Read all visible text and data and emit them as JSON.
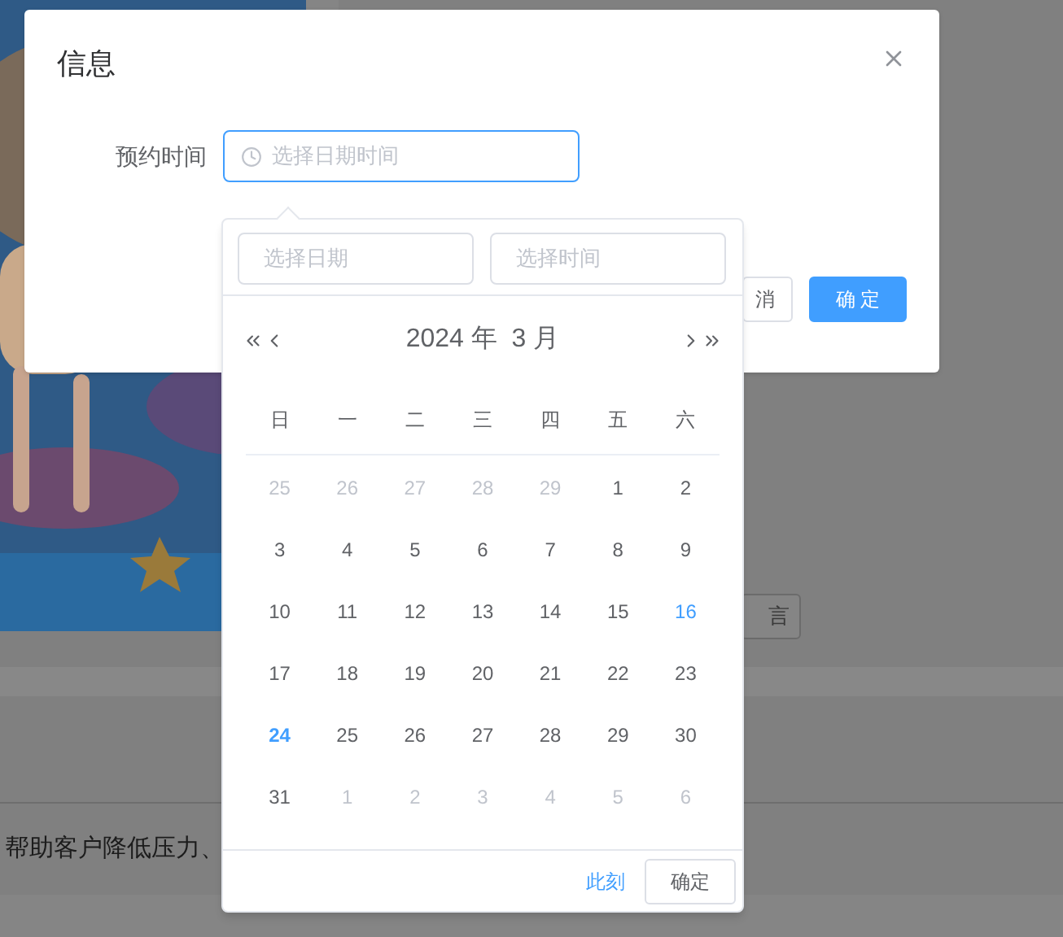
{
  "background": {
    "button": "言",
    "text": "帮助客户降低压力、"
  },
  "dialog": {
    "title": "信息",
    "field": {
      "label": "预约时间",
      "placeholder": "选择日期时间",
      "focused": true
    },
    "buttons": [
      {
        "label": "消",
        "kind": "default"
      },
      {
        "label": "确 定",
        "kind": "primary"
      }
    ]
  },
  "picker": {
    "date_placeholder": "选择日期",
    "time_placeholder": "选择时间",
    "title": "2024 年  3 月",
    "weekdays": [
      "日",
      "一",
      "二",
      "三",
      "四",
      "五",
      "六"
    ],
    "weeks": [
      [
        {
          "label": "25",
          "muted": true,
          "today": false,
          "marked": false
        },
        {
          "label": "26",
          "muted": true,
          "today": false,
          "marked": false
        },
        {
          "label": "27",
          "muted": true,
          "today": false,
          "marked": false
        },
        {
          "label": "28",
          "muted": true,
          "today": false,
          "marked": false
        },
        {
          "label": "29",
          "muted": true,
          "today": false,
          "marked": false
        },
        {
          "label": "1",
          "muted": false,
          "today": false,
          "marked": false
        },
        {
          "label": "2",
          "muted": false,
          "today": false,
          "marked": false
        }
      ],
      [
        {
          "label": "3",
          "muted": false,
          "today": false,
          "marked": false
        },
        {
          "label": "4",
          "muted": false,
          "today": false,
          "marked": false
        },
        {
          "label": "5",
          "muted": false,
          "today": false,
          "marked": false
        },
        {
          "label": "6",
          "muted": false,
          "today": false,
          "marked": false
        },
        {
          "label": "7",
          "muted": false,
          "today": false,
          "marked": false
        },
        {
          "label": "8",
          "muted": false,
          "today": false,
          "marked": false
        },
        {
          "label": "9",
          "muted": false,
          "today": false,
          "marked": false
        }
      ],
      [
        {
          "label": "10",
          "muted": false,
          "today": false,
          "marked": false
        },
        {
          "label": "11",
          "muted": false,
          "today": false,
          "marked": false
        },
        {
          "label": "12",
          "muted": false,
          "today": false,
          "marked": false
        },
        {
          "label": "13",
          "muted": false,
          "today": false,
          "marked": false
        },
        {
          "label": "14",
          "muted": false,
          "today": false,
          "marked": false
        },
        {
          "label": "15",
          "muted": false,
          "today": false,
          "marked": false
        },
        {
          "label": "16",
          "muted": false,
          "today": false,
          "marked": true
        }
      ],
      [
        {
          "label": "17",
          "muted": false,
          "today": false,
          "marked": false
        },
        {
          "label": "18",
          "muted": false,
          "today": false,
          "marked": false
        },
        {
          "label": "19",
          "muted": false,
          "today": false,
          "marked": false
        },
        {
          "label": "20",
          "muted": false,
          "today": false,
          "marked": false
        },
        {
          "label": "21",
          "muted": false,
          "today": false,
          "marked": false
        },
        {
          "label": "22",
          "muted": false,
          "today": false,
          "marked": false
        },
        {
          "label": "23",
          "muted": false,
          "today": false,
          "marked": false
        }
      ],
      [
        {
          "label": "24",
          "muted": false,
          "today": true,
          "marked": false
        },
        {
          "label": "25",
          "muted": false,
          "today": false,
          "marked": false
        },
        {
          "label": "26",
          "muted": false,
          "today": false,
          "marked": false
        },
        {
          "label": "27",
          "muted": false,
          "today": false,
          "marked": false
        },
        {
          "label": "28",
          "muted": false,
          "today": false,
          "marked": false
        },
        {
          "label": "29",
          "muted": false,
          "today": false,
          "marked": false
        },
        {
          "label": "30",
          "muted": false,
          "today": false,
          "marked": false
        }
      ],
      [
        {
          "label": "31",
          "muted": false,
          "today": false,
          "marked": false
        },
        {
          "label": "1",
          "muted": true,
          "today": false,
          "marked": false
        },
        {
          "label": "2",
          "muted": true,
          "today": false,
          "marked": false
        },
        {
          "label": "3",
          "muted": true,
          "today": false,
          "marked": false
        },
        {
          "label": "4",
          "muted": true,
          "today": false,
          "marked": false
        },
        {
          "label": "5",
          "muted": true,
          "today": false,
          "marked": false
        },
        {
          "label": "6",
          "muted": true,
          "today": false,
          "marked": false
        }
      ]
    ],
    "now_link": "此刻",
    "confirm": "确定"
  }
}
